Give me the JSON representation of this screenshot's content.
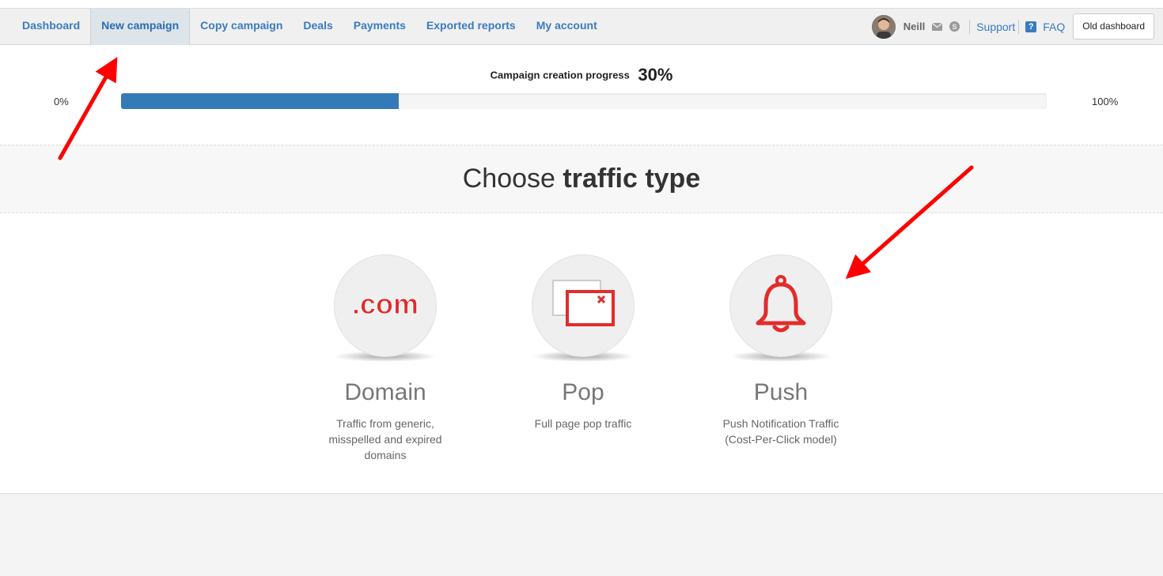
{
  "nav": {
    "items": [
      {
        "label": "Dashboard",
        "active": false
      },
      {
        "label": "New campaign",
        "active": true
      },
      {
        "label": "Copy campaign",
        "active": false
      },
      {
        "label": "Deals",
        "active": false
      },
      {
        "label": "Payments",
        "active": false
      },
      {
        "label": "Exported reports",
        "active": false
      },
      {
        "label": "My account",
        "active": false
      }
    ]
  },
  "header_right": {
    "user_name": "Neill",
    "support_label": "Support",
    "faq_label": "FAQ",
    "old_dashboard_label": "Old dashboard"
  },
  "progress": {
    "label": "Campaign creation progress",
    "percent_text": "30%",
    "value": 0.3,
    "min_label": "0%",
    "max_label": "100%",
    "fill_color": "#337ab7"
  },
  "section": {
    "title_prefix": "Choose",
    "title_bold": "traffic type"
  },
  "traffic_types": [
    {
      "name": "Domain",
      "icon": "dot-com-icon",
      "icon_text": ".com",
      "desc_lines": [
        "Traffic from generic,",
        "misspelled and expired",
        "domains"
      ]
    },
    {
      "name": "Pop",
      "icon": "popup-window-icon",
      "desc_lines": [
        "Full page pop traffic"
      ]
    },
    {
      "name": "Push",
      "icon": "bell-icon",
      "desc_lines": [
        "Push Notification Traffic",
        "(Cost-Per-Click model)"
      ]
    }
  ],
  "colors": {
    "link": "#3a7bbf",
    "icon_red": "#e32b2b",
    "annotation_arrow": "#ff0000"
  }
}
